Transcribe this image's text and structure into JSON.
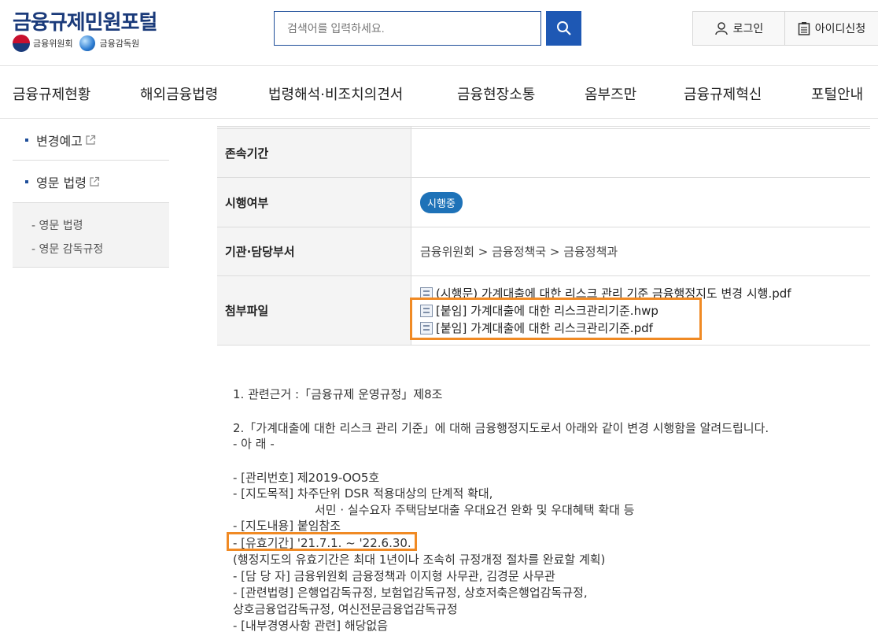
{
  "header": {
    "site_title": "금융규제민원포털",
    "org1": "금융위원회",
    "org2": "금융감독원",
    "search_placeholder": "검색어를 입력하세요.",
    "login_label": "로그인",
    "signup_label": "아이디신청"
  },
  "nav": {
    "items": [
      "금융규제현황",
      "해외금융법령",
      "법령해석·비조치의견서",
      "금융현장소통",
      "옴부즈만",
      "금융규제혁신",
      "포털안내"
    ]
  },
  "sidebar": {
    "items": [
      {
        "label": "변경예고"
      },
      {
        "label": "영문 법령"
      }
    ],
    "subitems": [
      "- 영문 법령",
      "- 영문 감독규정"
    ]
  },
  "table": {
    "rows": [
      {
        "header": "존속기간",
        "value": ""
      },
      {
        "header": "시행여부",
        "badge": "시행중"
      },
      {
        "header": "기관·담당부서",
        "value": "금융위원회 > 금융정책국 > 금융정책과"
      },
      {
        "header": "첨부파일"
      }
    ],
    "files": [
      "(시행문) 가계대출에 대한 리스크 관리 기준 금융행정지도 변경 시행.pdf",
      "[붙임] 가계대출에 대한 리스크관리기준.hwp",
      "[붙임] 가계대출에 대한 리스크관리기준.pdf"
    ]
  },
  "content": {
    "lines": [
      "1. 관련근거 :「금융규제 운영규정」제8조",
      "2.「가계대출에 대한 리스크 관리 기준」에 대해 금융행정지도로서 아래와 같이 변경 시행함을 알려드립니다.",
      "- 아      래 -",
      " - [관리번호] 제2019-OO5호",
      " - [지도목적] 차주단위 DSR 적용대상의 단계적 확대,",
      "서민 · 실수요자 주택담보대출 우대요건 완화 및 우대혜택 확대 등",
      " - [지도내용] 붙임참조",
      " - [유효기간] '21.7.1. ~ '22.6.30.",
      "(행정지도의 유효기간은 최대 1년이나 조속히 규정개정 절차를 완료할 계획)",
      " - [담 당 자] 금융위원회 금융정책과 이지형 사무관, 김경문 사무관",
      " - [관련법령] 은행업감독규정, 보험업감독규정, 상호저축은행업감독규정,",
      "상호금융업감독규정, 여신전문금융업감독규정",
      " - [내부경영사항 관련] 해당없음"
    ]
  },
  "colors": {
    "brand": "#1a3a7a",
    "search_button": "#1e58b4",
    "badge": "#1e72b8",
    "highlight": "#f08a24"
  }
}
